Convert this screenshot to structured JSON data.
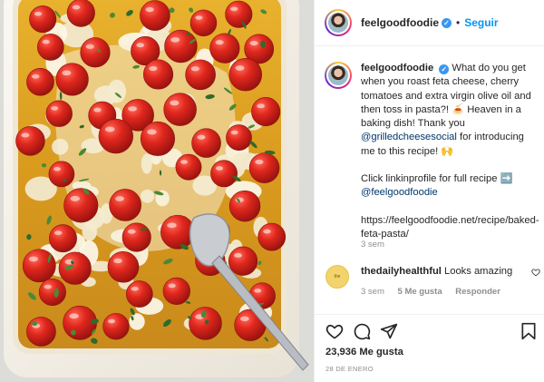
{
  "post": {
    "username": "feelgoodfoodie",
    "verified_mark": "✓",
    "separator": "•",
    "follow_label": "Seguir",
    "image_icon": "baked-feta-dish-photo"
  },
  "caption": {
    "username": "feelgoodfoodie",
    "text_1": "What do you get when you roast feta cheese, cherry tomatoes and extra virgin olive oil and then toss in pasta?!",
    "emoji_1": "🍝",
    "text_2": "Heaven in a baking dish! Thank you",
    "mention": "@grilledcheesesocial",
    "text_3": "for introducing me to this recipe!",
    "emoji_2": "🙌",
    "text_4": "Click linkinprofile for full recipe",
    "emoji_3": "➡️",
    "mention_2": "@feelgoodfoodie",
    "url": "https://feelgoodfoodie.net/recipe/baked-feta-pasta/",
    "time": "3 sem"
  },
  "comment": {
    "username": "thedailyhealthful",
    "text": "Looks amazing",
    "time": "3 sem",
    "likes": "5 Me gusta",
    "reply_label": "Responder",
    "avatar_text": "the dailyhealthful"
  },
  "footer": {
    "likes": "23,936 Me gusta",
    "date": "28 DE ENERO",
    "icons": [
      "heart-icon",
      "comment-icon",
      "share-icon",
      "bookmark-icon"
    ]
  },
  "colors": {
    "link": "#00376b",
    "follow": "#0095f6",
    "muted": "#8e8e8e",
    "verified": "#3897f0"
  }
}
